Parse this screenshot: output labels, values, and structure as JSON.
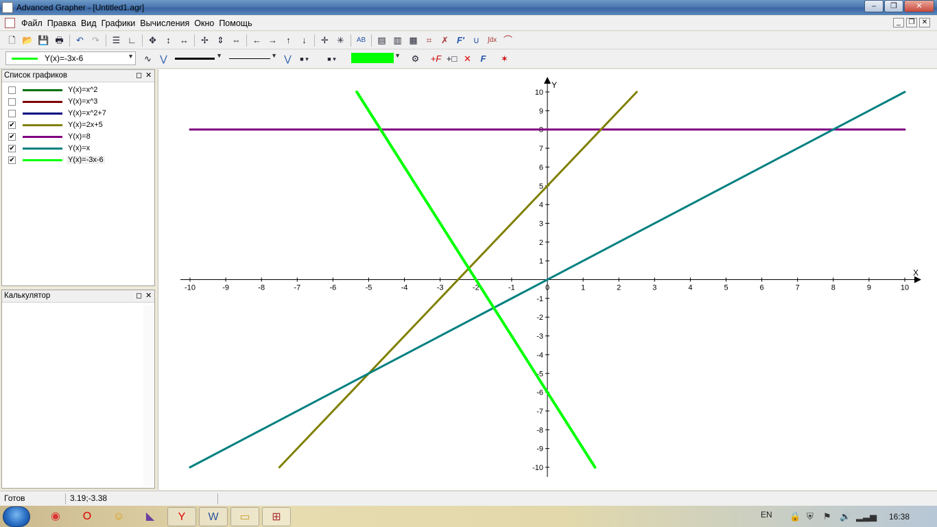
{
  "window": {
    "title": "Advanced Grapher - [Untitled1.agr]",
    "buttons": [
      "–",
      "❐",
      "✕"
    ]
  },
  "menubar": {
    "items": [
      "Файл",
      "Правка",
      "Вид",
      "Графики",
      "Вычисления",
      "Окно",
      "Помощь"
    ]
  },
  "toolbar2": {
    "function_combo": "Y(x)=-3x-6",
    "accent_color": "#00ff00"
  },
  "graph_list": {
    "title": "Список графиков",
    "items": [
      {
        "label": "Y(x)=x^2",
        "checked": false,
        "color": "#007000"
      },
      {
        "label": "Y(x)=x^3",
        "checked": false,
        "color": "#800000"
      },
      {
        "label": "Y(x)=x^2+7",
        "checked": false,
        "color": "#000080"
      },
      {
        "label": "Y(x)=2x+5",
        "checked": true,
        "color": "#808000"
      },
      {
        "label": "Y(x)=8",
        "checked": true,
        "color": "#800080"
      },
      {
        "label": "Y(x)=x",
        "checked": true,
        "color": "#008080"
      },
      {
        "label": "Y(x)=-3x-6",
        "checked": true,
        "color": "#00ff00"
      }
    ]
  },
  "calculator": {
    "title": "Калькулятор"
  },
  "chart_data": {
    "type": "line",
    "xlabel": "X",
    "ylabel": "Y",
    "xlim": [
      -10,
      10
    ],
    "ylim": [
      -10,
      10
    ],
    "x_ticks": [
      -10,
      -9,
      -8,
      -7,
      -6,
      -5,
      -4,
      -3,
      -2,
      -1,
      0,
      1,
      2,
      3,
      4,
      5,
      6,
      7,
      8,
      9,
      10
    ],
    "y_ticks": [
      -10,
      -9,
      -8,
      -7,
      -6,
      -5,
      -4,
      -3,
      -2,
      -1,
      1,
      2,
      3,
      4,
      5,
      6,
      7,
      8,
      9,
      10
    ],
    "series": [
      {
        "name": "Y(x)=8",
        "color": "#800080",
        "x": [
          -10,
          10
        ],
        "y": [
          8,
          8
        ]
      },
      {
        "name": "Y(x)=2x+5",
        "color": "#808000",
        "x": [
          -7.5,
          2.5
        ],
        "y": [
          -10,
          10
        ]
      },
      {
        "name": "Y(x)=x",
        "color": "#008080",
        "x": [
          -10,
          10
        ],
        "y": [
          -10,
          10
        ]
      },
      {
        "name": "Y(x)=-3x-6",
        "color": "#00ff00",
        "x": [
          -5.333,
          1.333
        ],
        "y": [
          10,
          -10
        ]
      }
    ]
  },
  "status": {
    "state": "Готов",
    "coords": "3.19;-3.38"
  },
  "taskbar": {
    "lang": "EN",
    "clock": "16:38"
  }
}
